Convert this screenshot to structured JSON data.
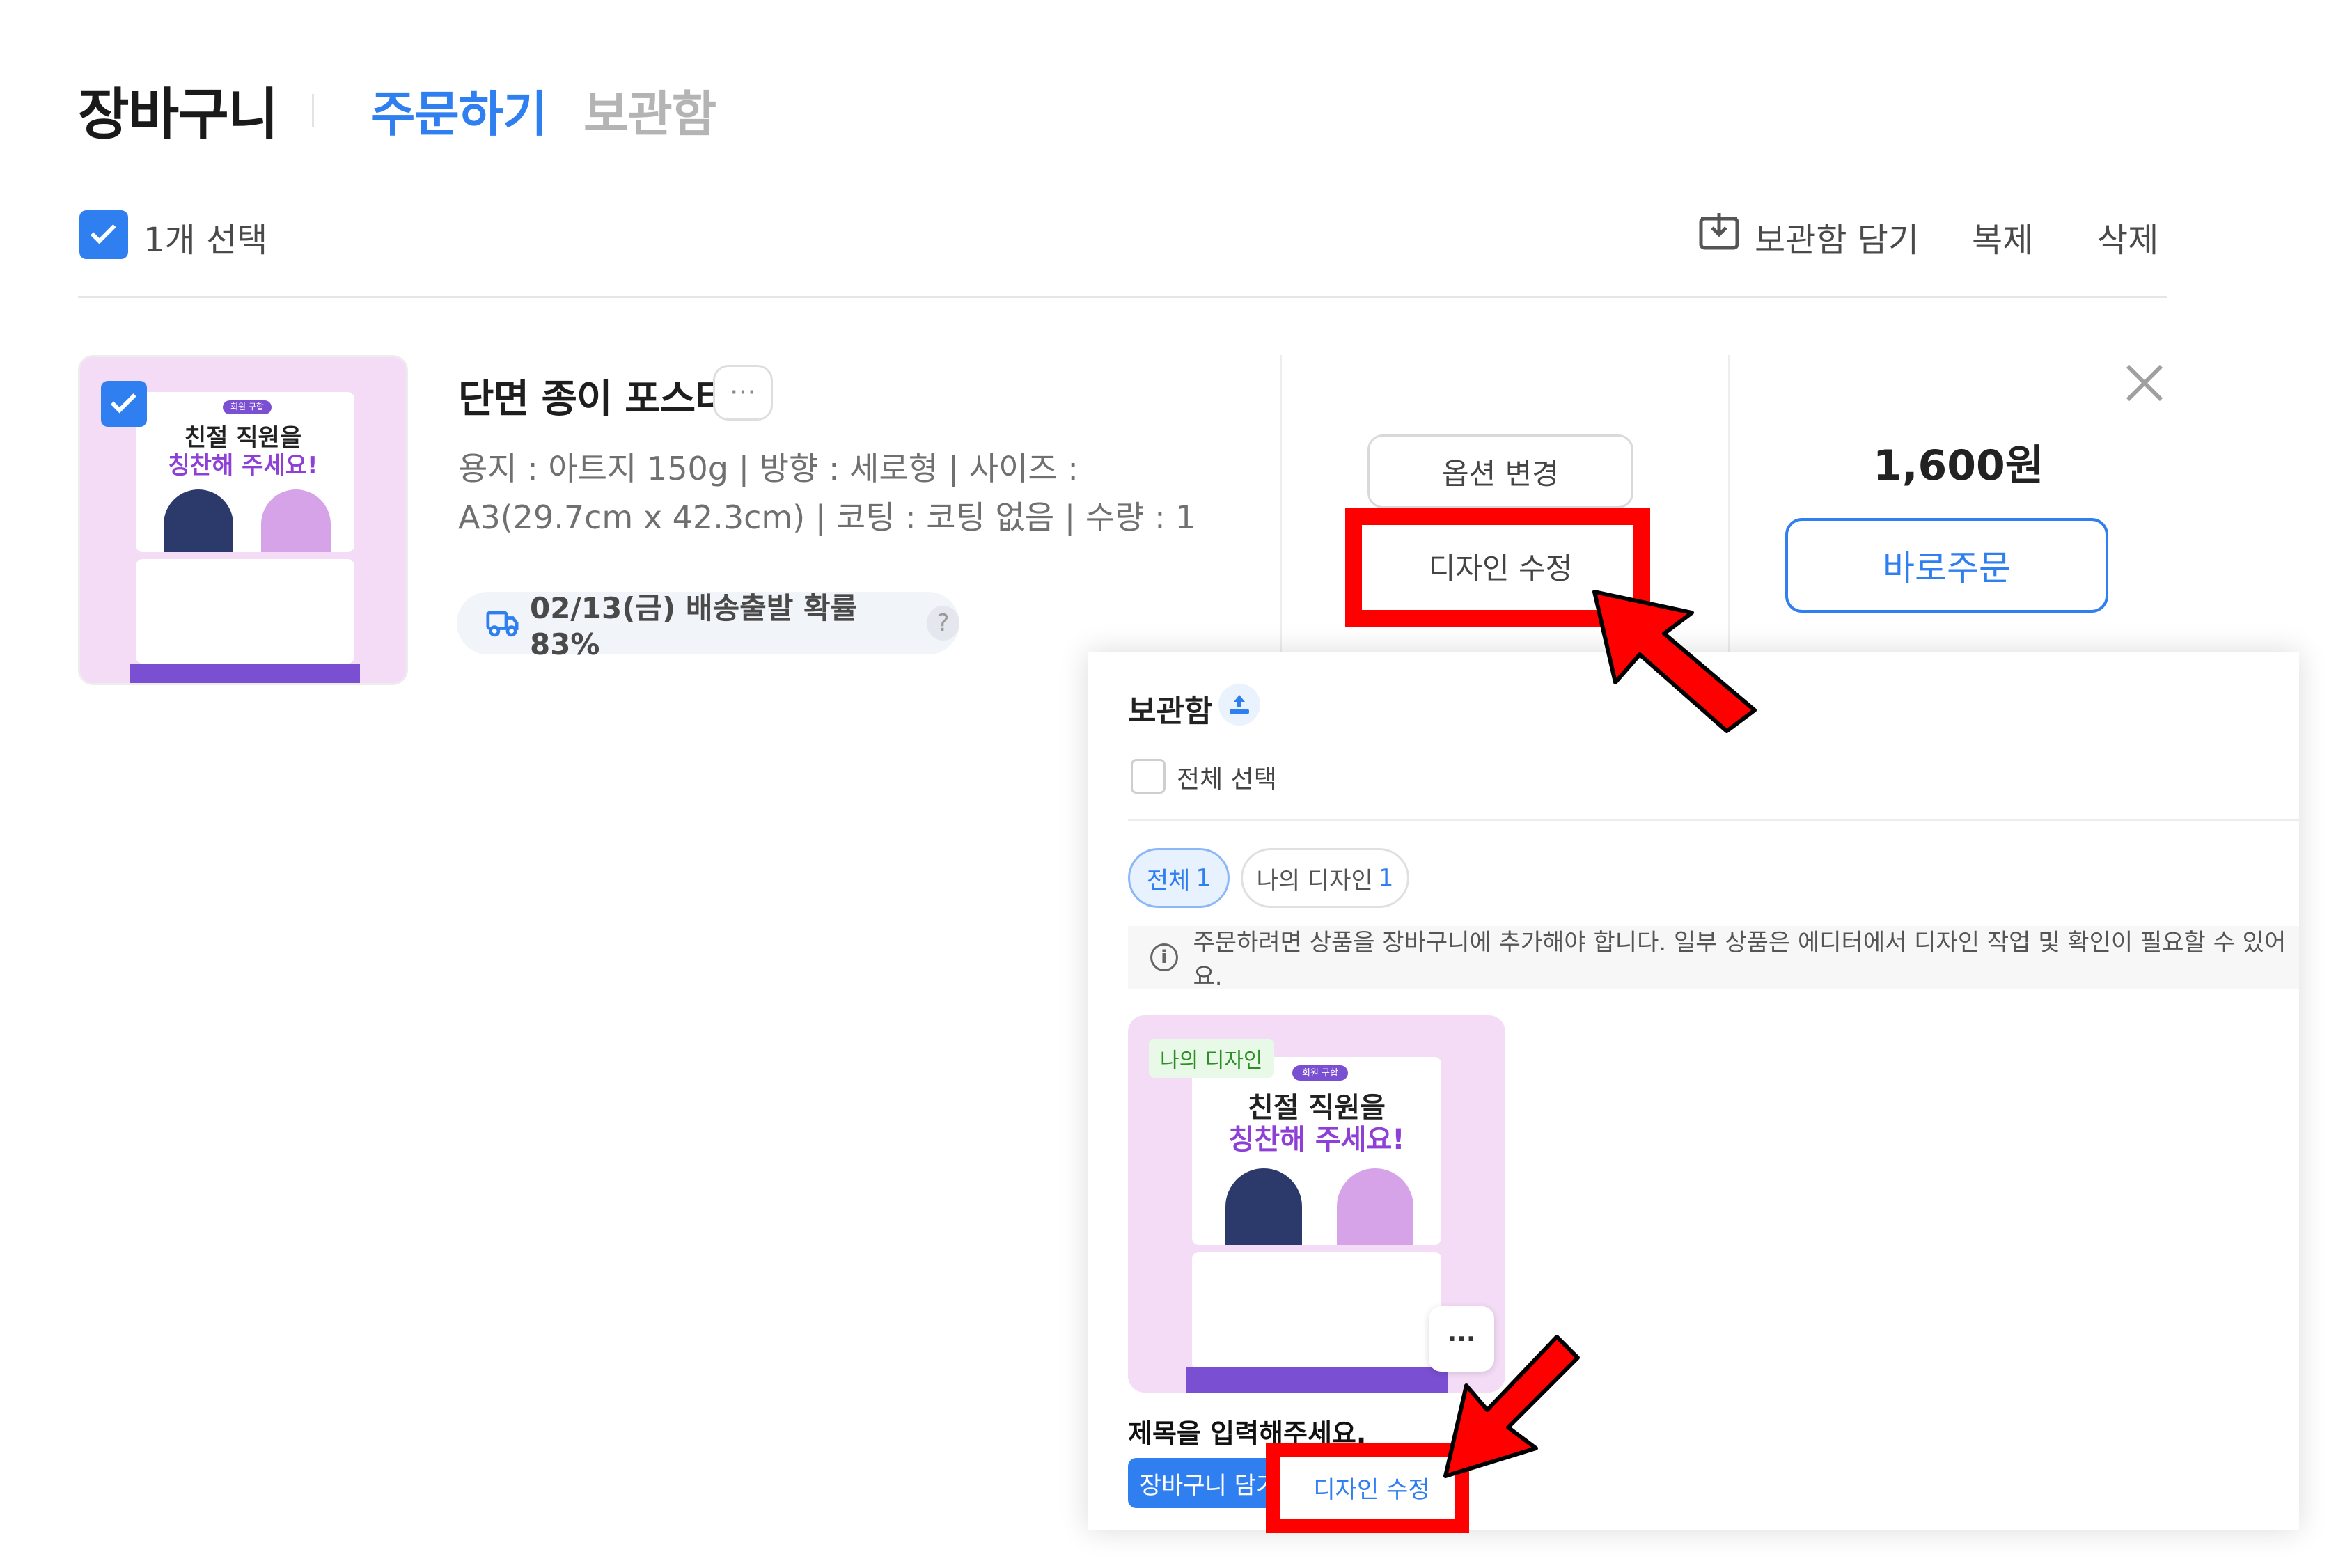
{
  "header": {
    "title": "장바구니",
    "tabs": [
      {
        "label": "주문하기",
        "active": true
      },
      {
        "label": "보관함",
        "active": false
      }
    ]
  },
  "select_bar": {
    "count_label": "1개 선택",
    "actions": [
      "보관함 담기",
      "복제",
      "삭제"
    ]
  },
  "product": {
    "name": "단면 종이 포스터",
    "more_label": "···",
    "spec": "용지 : 아트지 150g | 방향 : 세로형 | 사이즈 : A3(29.7cm x 42.3cm) | 코팅 : 코팅 없음 | 수량 : 1",
    "shipping": "02/13(금) 배송출발 확률 83%",
    "help_label": "?",
    "option_button": "옵션 변경",
    "edit_button": "디자인 수정",
    "price": "1,600원",
    "buy_button": "바로주문"
  },
  "poster": {
    "tag": "회원 구합",
    "headline_1": "친절 직원을",
    "headline_2": "칭찬해 주세요!"
  },
  "storage_panel": {
    "title": "보관함",
    "select_all": "전체 선택",
    "chips": [
      {
        "label": "전체",
        "count": "1"
      },
      {
        "label": "나의 디자인",
        "count": "1"
      }
    ],
    "notice": "주문하려면 상품을 장바구니에 추가해야 합니다. 일부 상품은 에디터에서 디자인 작업 및 확인이 필요할 수 있어요.",
    "info_label": "i",
    "item": {
      "badge": "나의 디자인",
      "more_label": "···",
      "title": "제목을 입력해주세요.",
      "cart_button": "장바구니 담기",
      "edit_button": "디자인 수정"
    }
  },
  "colors": {
    "accent": "#2f7ff0",
    "highlight": "#ff0000",
    "poster_bg": "#f4dcf6",
    "poster_purple": "#7b4fd1"
  }
}
